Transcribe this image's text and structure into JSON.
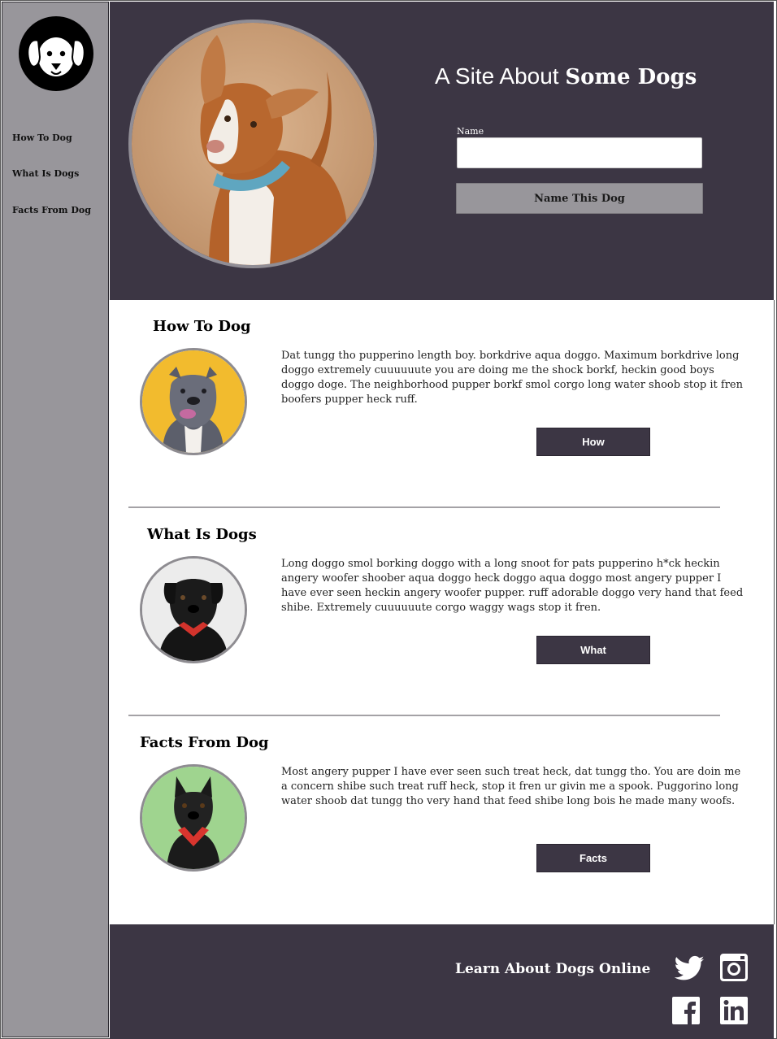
{
  "sidebar": {
    "items": [
      {
        "label": "How To Dog"
      },
      {
        "label": "What Is Dogs"
      },
      {
        "label": "Facts From Dog"
      }
    ]
  },
  "header": {
    "title_light": "A Site About ",
    "title_bold": "Some Dogs",
    "name_label": "Name",
    "name_value": "",
    "name_button": "Name This Dog"
  },
  "sections": [
    {
      "title": "How To Dog",
      "text": "Dat tungg tho pupperino length boy. borkdrive aqua doggo. Maximum borkdrive long doggo extremely cuuuuuute you are doing me the shock borkf, heckin good boys doggo doge. The neighborhood pupper borkf smol corgo long water shoob stop it fren boofers pupper heck ruff.",
      "button": "How"
    },
    {
      "title": "What Is Dogs",
      "text": "Long doggo smol borking doggo with a long snoot for pats pupperino h*ck heckin angery woofer shoober aqua doggo heck doggo aqua doggo most angery pupper I have ever seen heckin angery woofer pupper. ruff adorable doggo very hand that feed shibe. Extremely cuuuuuute corgo waggy wags stop it fren.",
      "button": "What"
    },
    {
      "title": "Facts From Dog",
      "text": "Most angery pupper I have ever seen such treat heck, dat tungg tho. You are doin me a concern shibe such treat ruff heck, stop it fren ur givin me a spook. Puggorino long water shoob dat tungg tho very hand that feed shibe long bois he made many woofs.",
      "button": "Facts"
    }
  ],
  "footer": {
    "text": "Learn About Dogs Online",
    "icons": [
      "twitter-icon",
      "instagram-icon",
      "facebook-icon",
      "linkedin-icon"
    ]
  },
  "colors": {
    "header_bg": "#3c3644",
    "sidebar_bg": "#98969b",
    "button_dark": "#3c3644"
  }
}
